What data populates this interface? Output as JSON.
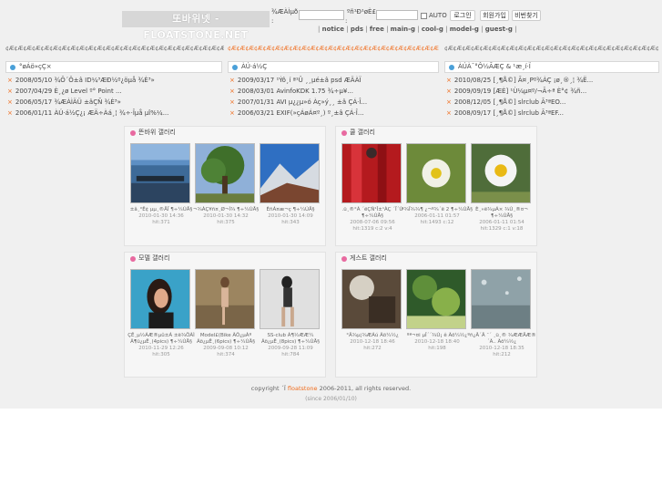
{
  "header": {
    "logo_text": "또바위넷 - FLOATSTONE.NET",
    "id_label": "¾ÆÀÌµð",
    "pw_label": "ºñ¹Ð¹øÈ£",
    "auto_label": "AUTO",
    "login_button": "로그인",
    "signup_button": "회원가입",
    "find_pw_button": "비번찾기"
  },
  "nav": {
    "items": [
      "notice",
      "pds",
      "free",
      "main-g",
      "cool-g",
      "model-g",
      "guest-g"
    ]
  },
  "columns": [
    {
      "title": "¢Æ¢Æ¢Æ¢Æ¢Æ¢Æ¢Æ¢Æ¢Æ¢Æ¢Æ¢Æ¢Æ¢Æ¢Æ¢Æ¢Æ¢Æ¢Æ¢Æ¢Æ¢Æ¢Æ¢Æ¢Æ¢Æ¢Æ",
      "tab": "°øÁö»çÇ×",
      "posts": [
        {
          "date": "2008/05/10",
          "text": "¾Õ´Ô±â ID¼³ÆÐ½º¿öµå ¾È³»"
        },
        {
          "date": "2007/04/29",
          "text": "È¸¿ø Level º° Point ..."
        },
        {
          "date": "2006/05/17",
          "text": "¾ÆÀÌÄÜ ±âÇÑ ¾È³»"
        },
        {
          "date": "2006/01/11",
          "text": "ÀÚ·á½Ç¿¡ ÆÄ÷Àá¸¦ ¾÷·Îµå µî%¼..."
        }
      ]
    },
    {
      "title": "¢Æ¢Æ¢Æ¢Æ¢Æ¢Æ¢Æ¢Æ¢Æ¢Æ¢Æ¢Æ¢Æ¢Æ¢Æ¢Æ¢Æ¢Æ¢Æ¢Æ¢Æ¢Æ¢Æ¢Æ¢Æ¢Æ¢Æ",
      "tab": "ÀÚ·á½Ç",
      "posts": [
        {
          "date": "2009/03/17",
          "text": "¹Ýô¸í ª¹Û ¸¸µé±â psd ÆÄÀÏ"
        },
        {
          "date": "2008/03/01",
          "text": "AvinfoKDK 1.75 ¾÷µ¥..."
        },
        {
          "date": "2007/01/31",
          "text": "AVI µ¿¿µ»ó Àç»ý¸¸ ±â ÇÁ·Î..."
        },
        {
          "date": "2006/03/21",
          "text": "EXIF(»çÁøÁ¤º¸) º¸±â ÇÁ·Î..."
        }
      ]
    },
    {
      "title": "¢Æ¢Æ¢Æ¢Æ¢Æ¢Æ¢Æ¢Æ¢Æ¢Æ¢Æ¢Æ¢Æ¢Æ¢Æ¢Æ¢Æ¢Æ¢Æ¢Æ¢Æ¢Æ¢Æ¢Æ¢Æ¢Æ¢Æ",
      "tab": "ÀÚÀ¯°Ô½ÃÆÇ & ¹æ¸í·Ï",
      "posts": [
        {
          "date": "2010/08/25",
          "text": "[¸¶Å©] Ã¤¸Pº¾ÀÇ ¡ø¸®¸¦ ¾Ë..."
        },
        {
          "date": "2009/09/19",
          "text": "[ÆÈ] ¹Ù¼µ¤º/¬Ã÷ª È°¢ ¾ñ..."
        },
        {
          "date": "2008/12/05",
          "text": "[¸¶Å©] slrclub Ã³ªEO..."
        },
        {
          "date": "2008/09/17",
          "text": "[¸¶Å©] slrclub Ã³ªEF..."
        }
      ]
    }
  ],
  "galleries": [
    {
      "title": "뜬바위 갤러리",
      "items": [
        {
          "caption": "±â¸°Ê¢ µµ¸®ÅÏ ¶÷¼ÚÅ§",
          "date": "2010-01-30 14:36",
          "hits": "hit:371",
          "extra": ""
        },
        {
          "caption": "¬¾ÀÇ¥ñ¤¸Ø¬Ì¾ ¶÷¼ÚÅ§",
          "date": "2010-01-30 14:32",
          "hits": "hit:375",
          "extra": ""
        },
        {
          "caption": "ÈñÁ¤æ¬ç ¶÷¼ÚÅ§",
          "date": "2010-01-30 14:09",
          "hits": "hit:343",
          "extra": ""
        }
      ]
    },
    {
      "title": "쿨 갤러리",
      "items": [
        {
          "caption": ".ü¸®°Á ´ëÇÑ¹Î±¹ÀÇ ´Ï´Ù ¶÷¼ÚÅ§",
          "date": "2008-07-06 09:56",
          "hits": "hit:1319",
          "extra": "c:2 v:4"
        },
        {
          "caption": "ª¾Ï¾¾¶ ¿¬º¾´ë 2 ¶÷¼ÚÅ§",
          "date": "2006-01-11 01:57",
          "hits": "hit:1493",
          "extra": "c:12"
        },
        {
          "caption": "È¸»ë¾µÁ× ¾Ù¸®¤¬ ¶÷¼ÚÅ§",
          "date": "2006-01-11 01:54",
          "hits": "hit:1329",
          "extra": "c:1 v:18"
        }
      ]
    },
    {
      "title": "모델 갤러리",
      "items": [
        {
          "caption": "ÇÊ¸µ½ÁÆ®µû±Á ±ë¾ÖÀÌ Ã¶ü¿µÊ¸(4pics) ¶÷¼ÚÅ§",
          "date": "2010-11-29 12:26",
          "hits": "hit:305",
          "extra": ""
        },
        {
          "caption": "Model£(Bike ÃÔ¿µÀº Ãö¿µÊ¸(6pics) ¶÷¼ÚÅ§",
          "date": "2009-09-08 10:12",
          "hits": "hit:374",
          "extra": ""
        },
        {
          "caption": "SS-club Á¶½ÆÆ¼ Ãö¿µÊ¸(8pics) ¶÷¼ÚÅ§",
          "date": "2009-09-28 11:09",
          "hits": "hit:784",
          "extra": ""
        }
      ]
    },
    {
      "title": "게스트 갤러리",
      "items": [
        {
          "caption": "°Â¾µ¦¾ÆÁú Ãö¼½¿",
          "date": "2010-12-18 18:46",
          "hits": "hit:272",
          "extra": ""
        },
        {
          "caption": "ºª¬¤i µÎ´´¾Ù¡ ê Ãö¼½¿",
          "date": "2010-12-18 18:40",
          "hits": "hit:198",
          "extra": ""
        },
        {
          "caption": "ºñ¿Â´Â ¯´ ¸ü¸® ¾ÆÆÄÆ® ´Ã.. Ãö¼½¿",
          "date": "2010-12-18 18:35",
          "hits": "hit:212",
          "extra": ""
        }
      ]
    }
  ],
  "footer": {
    "copyright_prefix": "copyright ´Ï",
    "brand": "floatstone",
    "copyright_suffix": "2006-2011, all rights reserved.",
    "since": "(since 2006/01/10)"
  }
}
